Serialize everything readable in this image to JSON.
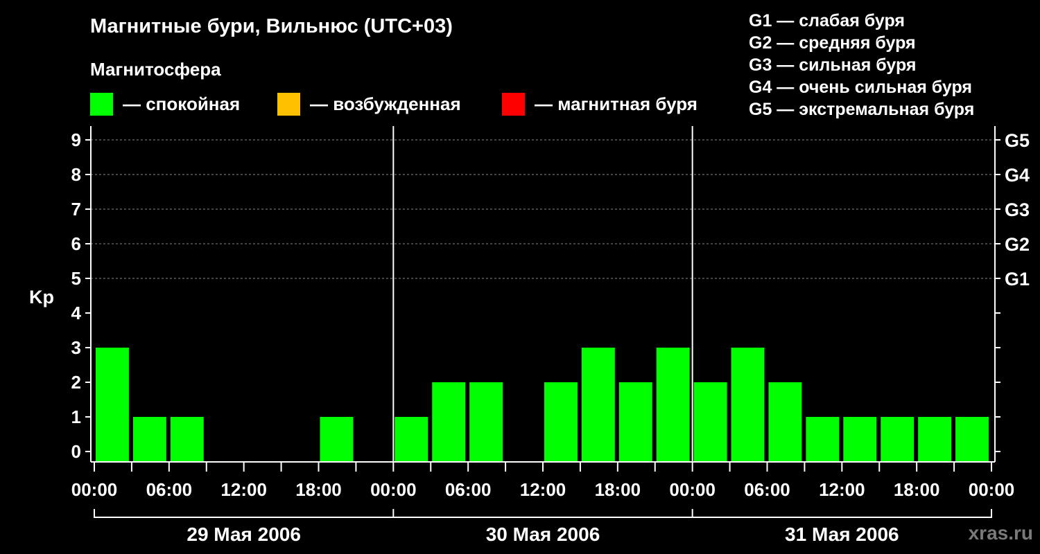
{
  "title": "Магнитные бури, Вильнюс (UTC+03)",
  "subtitle": "Магнитосфера",
  "legend": [
    {
      "label": "— спокойная",
      "color": "#00ff00"
    },
    {
      "label": "— возбужденная",
      "color": "#ffc000"
    },
    {
      "label": "— магнитная буря",
      "color": "#ff0000"
    }
  ],
  "storm_legend": [
    "G1 — слабая буря",
    "G2 — средняя буря",
    "G3 — сильная буря",
    "G4 — очень сильная буря",
    "G5 — экстремальная буря"
  ],
  "watermark": "xras.ru",
  "chart_data": {
    "type": "bar",
    "ylabel": "Kp",
    "ylim": [
      0,
      9
    ],
    "yticks": [
      0,
      1,
      2,
      3,
      4,
      5,
      6,
      7,
      8,
      9
    ],
    "right_axis_labels": [
      {
        "kp": 5,
        "label": "G1"
      },
      {
        "kp": 6,
        "label": "G2"
      },
      {
        "kp": 7,
        "label": "G3"
      },
      {
        "kp": 8,
        "label": "G4"
      },
      {
        "kp": 9,
        "label": "G5"
      }
    ],
    "grid": "horizontal dashed at Kp 5-9",
    "xtick_labels": [
      "00:00",
      "06:00",
      "12:00",
      "18:00",
      "00:00",
      "06:00",
      "12:00",
      "18:00",
      "00:00",
      "06:00",
      "12:00",
      "18:00",
      "00:00"
    ],
    "days": [
      "29 Мая 2006",
      "30 Мая 2006",
      "31 Мая 2006"
    ],
    "interval_hours": 3,
    "values": [
      3,
      1,
      1,
      0,
      0,
      0,
      1,
      0,
      1,
      2,
      2,
      0,
      2,
      3,
      2,
      3,
      2,
      3,
      2,
      1,
      1,
      1,
      1,
      1
    ],
    "colors": {
      "quiet": "#00ff00",
      "unsettled": "#ffc000",
      "storm": "#ff0000"
    }
  }
}
